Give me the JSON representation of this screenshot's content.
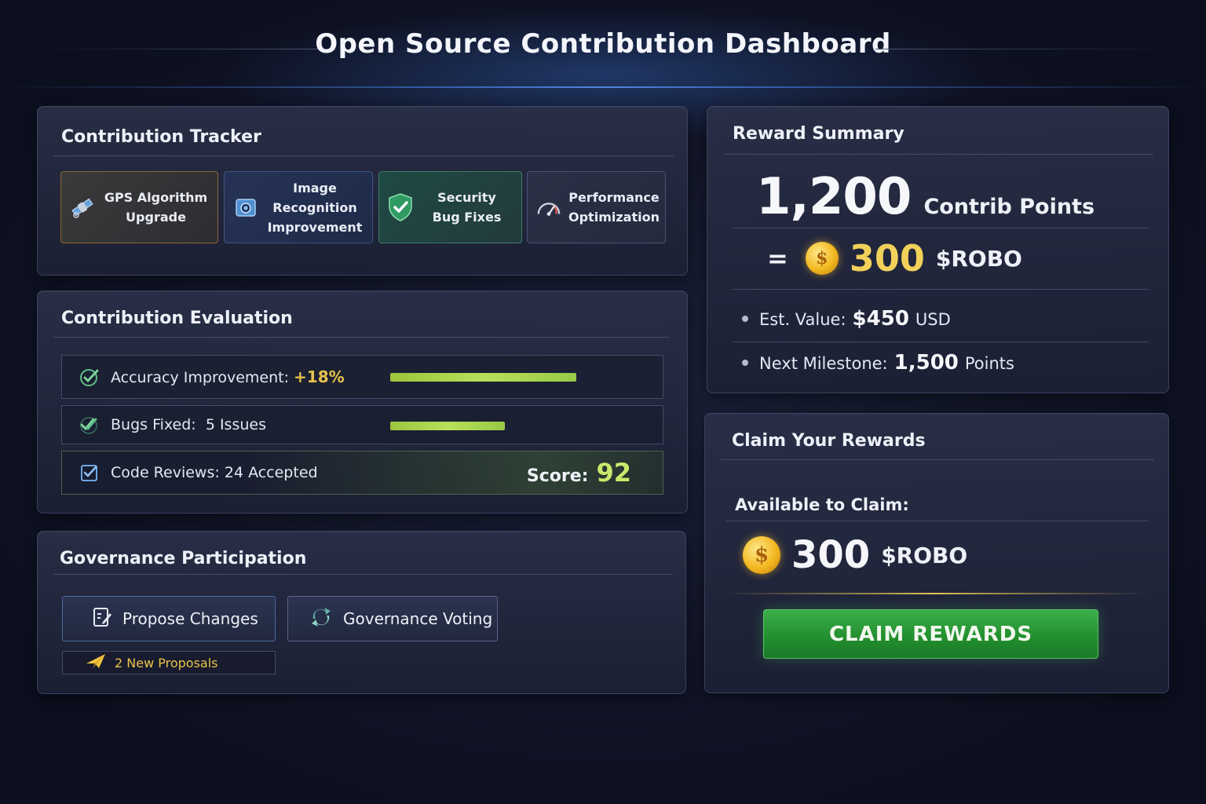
{
  "header": {
    "title": "Open Source Contribution Dashboard"
  },
  "tracker": {
    "title": "Contribution Tracker",
    "cards": [
      {
        "line1": "GPS Algorithm",
        "line2": "Upgrade",
        "icon": "satellite-icon"
      },
      {
        "line1": "Image Recognition",
        "line2": "Improvement",
        "icon": "camera-icon"
      },
      {
        "line1": "Security",
        "line2": "Bug Fixes",
        "icon": "shield-check-icon"
      },
      {
        "line1": "Performance",
        "line2": "Optimization",
        "icon": "speedometer-icon"
      }
    ]
  },
  "evaluation": {
    "title": "Contribution Evaluation",
    "accuracy": {
      "label": "Accuracy Improvement:",
      "value": "+18%",
      "progress": 0.73
    },
    "bugs": {
      "label": "Bugs Fixed:",
      "value": "5",
      "suffix": "Issues",
      "progress": 0.45
    },
    "reviews": {
      "label": "Code Reviews:",
      "value": "24",
      "suffix": "Accepted"
    },
    "score": {
      "label": "Score:",
      "value": "92"
    }
  },
  "governance": {
    "title": "Governance Participation",
    "propose_label": "Propose Changes",
    "voting_label": "Governance Voting",
    "proposals_label": "2 New Proposals"
  },
  "summary": {
    "title": "Reward Summary",
    "points": "1,200",
    "points_unit": "Contrib Points",
    "equals": "=",
    "robo_amount": "300",
    "robo_unit": "$ROBO",
    "est_label": "Est. Value:",
    "est_value": "$450",
    "est_unit": "USD",
    "milestone_label": "Next Milestone:",
    "milestone_value": "1,500",
    "milestone_unit": "Points"
  },
  "claim": {
    "title": "Claim Your Rewards",
    "available_label": "Available to Claim:",
    "amount": "300",
    "unit": "$ROBO",
    "button_label": "CLAIM REWARDS"
  },
  "colors": {
    "accent_gold": "#f2d15a",
    "progress_green": "#b7e05a",
    "claim_green": "#23902f",
    "background": "#121629"
  }
}
